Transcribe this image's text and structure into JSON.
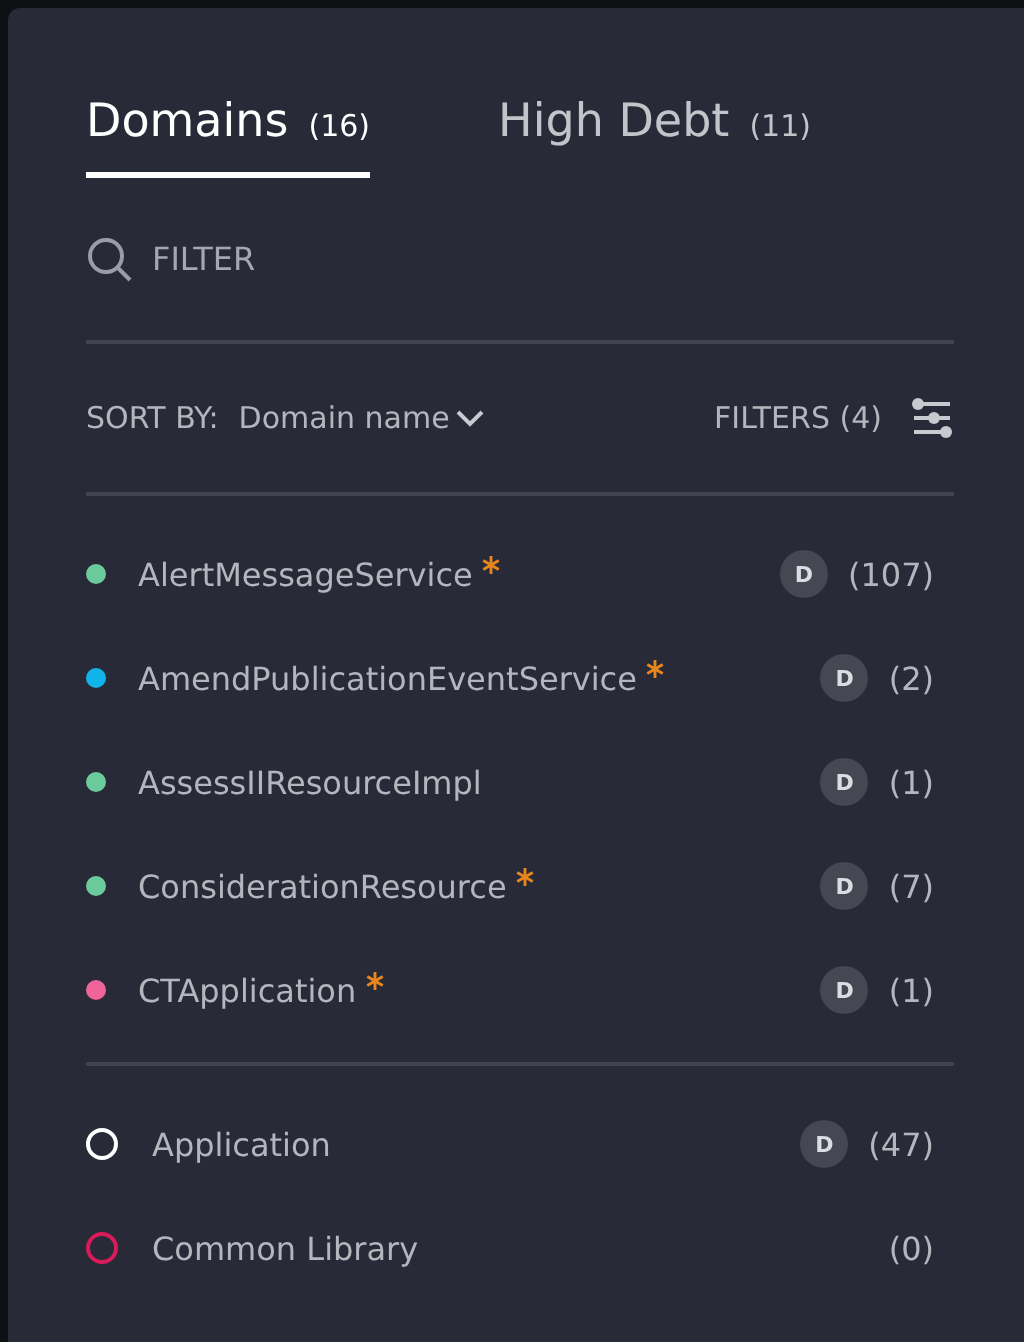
{
  "tabs": [
    {
      "label": "Domains",
      "count": "(16)",
      "selected": true
    },
    {
      "label": "High Debt",
      "count": "(11)",
      "selected": false
    }
  ],
  "search": {
    "placeholder": "FILTER"
  },
  "sort": {
    "label": "SORT BY:",
    "value": "Domain name"
  },
  "filters": {
    "label": "FILTERS (4)"
  },
  "domains": [
    {
      "name": "AlertMessageService",
      "color": "#6ccb9a",
      "starred": true,
      "badge": "D",
      "count": "(107)"
    },
    {
      "name": "AmendPublicationEventService",
      "color": "#10b4e8",
      "starred": true,
      "badge": "D",
      "count": "(2)"
    },
    {
      "name": "AssessIIResourceImpl",
      "color": "#6ccb9a",
      "starred": false,
      "badge": "D",
      "count": "(1)"
    },
    {
      "name": "ConsiderationResource",
      "color": "#6ccb9a",
      "starred": true,
      "badge": "D",
      "count": "(7)"
    },
    {
      "name": "CTApplication",
      "color": "#f0649a",
      "starred": true,
      "badge": "D",
      "count": "(1)"
    }
  ],
  "groups": [
    {
      "name": "Application",
      "color": "#ffffff",
      "badge": "D",
      "count": "(47)"
    },
    {
      "name": "Common Library",
      "color": "#d81b5a",
      "count": "(0)"
    }
  ]
}
